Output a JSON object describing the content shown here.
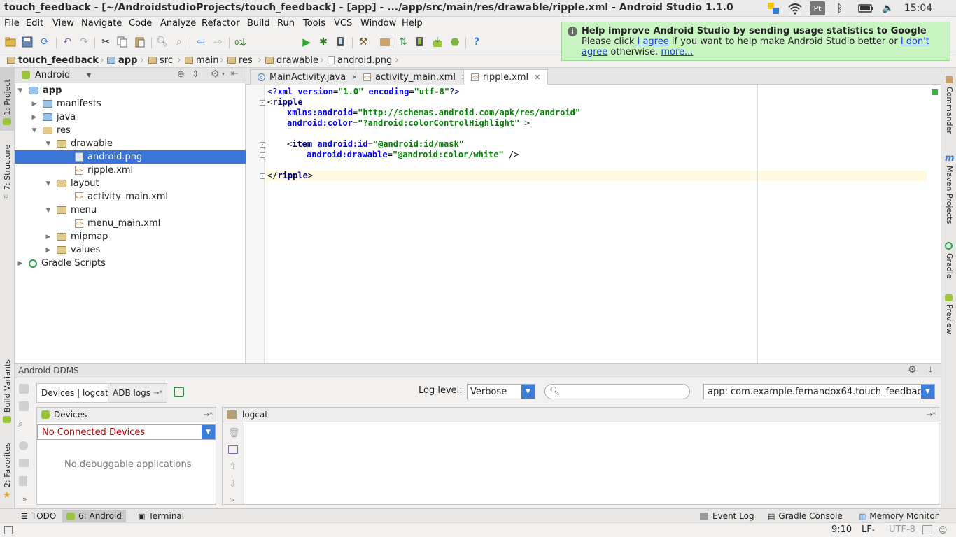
{
  "window": {
    "title": "touch_feedback - [~/AndroidstudioProjects/touch_feedback] - [app] - .../app/src/main/res/drawable/ripple.xml - Android Studio 1.1.0",
    "clock": "15:04"
  },
  "menu": [
    "File",
    "Edit",
    "View",
    "Navigate",
    "Code",
    "Analyze",
    "Refactor",
    "Build",
    "Run",
    "Tools",
    "VCS",
    "Window",
    "Help"
  ],
  "toolbar": {
    "run_config": "app"
  },
  "breadcrumb": [
    "touch_feedback",
    "app",
    "src",
    "main",
    "res",
    "drawable",
    "android.png"
  ],
  "project_view": {
    "mode": "Android",
    "tree": [
      {
        "label": "app"
      },
      {
        "label": "manifests"
      },
      {
        "label": "java"
      },
      {
        "label": "res"
      },
      {
        "label": "drawable"
      },
      {
        "label": "android.png"
      },
      {
        "label": "ripple.xml"
      },
      {
        "label": "layout"
      },
      {
        "label": "activity_main.xml"
      },
      {
        "label": "menu"
      },
      {
        "label": "menu_main.xml"
      },
      {
        "label": "mipmap"
      },
      {
        "label": "values"
      },
      {
        "label": "Gradle Scripts"
      }
    ]
  },
  "left_tool_windows": [
    "1: Project",
    "7: Structure",
    "Build Variants",
    "2: Favorites"
  ],
  "right_tool_windows": [
    "Commander",
    "Maven Projects",
    "Gradle",
    "Preview"
  ],
  "editor_tabs": [
    {
      "label": "MainActivity.java"
    },
    {
      "label": "activity_main.xml"
    },
    {
      "label": "ripple.xml",
      "active": true
    }
  ],
  "code": {
    "l1_a": "<?",
    "l1_b": "xml version",
    "l1_c": "=",
    "l1_d": "\"1.0\"",
    "l1_e": " encoding",
    "l1_f": "=",
    "l1_g": "\"utf-8\"",
    "l1_h": "?>",
    "l2_a": "<",
    "l2_b": "ripple",
    "l3_a": "xmlns:android",
    "l3_b": "=",
    "l3_c": "\"http://schemas.android.com/apk/res/android\"",
    "l4_a": "android:color",
    "l4_b": "=",
    "l4_c": "\"?android:colorControlHighlight\"",
    "l4_d": " >",
    "l6_a": "<",
    "l6_b": "item ",
    "l6_c": "android:id",
    "l6_d": "=",
    "l6_e": "\"@android:id/mask\"",
    "l7_a": "android:drawable",
    "l7_b": "=",
    "l7_c": "\"@android:color/white\"",
    "l7_d": " />",
    "l9_a": "</",
    "l9_b": "ripple",
    "l9_c": ">"
  },
  "ddms": {
    "title": "Android DDMS",
    "tabs": [
      "Devices | logcat",
      "ADB logs"
    ],
    "log_level_label": "Log level:",
    "log_level": "Verbose",
    "app_filter": "app: com.example.fernandox64.touch_feedback",
    "devices_title": "Devices",
    "device_select": "No Connected Devices",
    "no_apps": "No debuggable applications",
    "logcat_title": "logcat"
  },
  "bottom_tools": [
    "TODO",
    "6: Android",
    "Terminal",
    "Event Log",
    "Gradle Console",
    "Memory Monitor"
  ],
  "status": {
    "position": "9:10",
    "line_sep": "LF",
    "encoding": "UTF-8"
  },
  "notification": {
    "title": "Help improve Android Studio by sending usage statistics to Google",
    "text1": "Please click ",
    "agree": "I agree",
    "text2": " if you want to help make Android Studio better or ",
    "dont_agree": "I don't agree",
    "text3": " otherwise. ",
    "more": "more..."
  }
}
